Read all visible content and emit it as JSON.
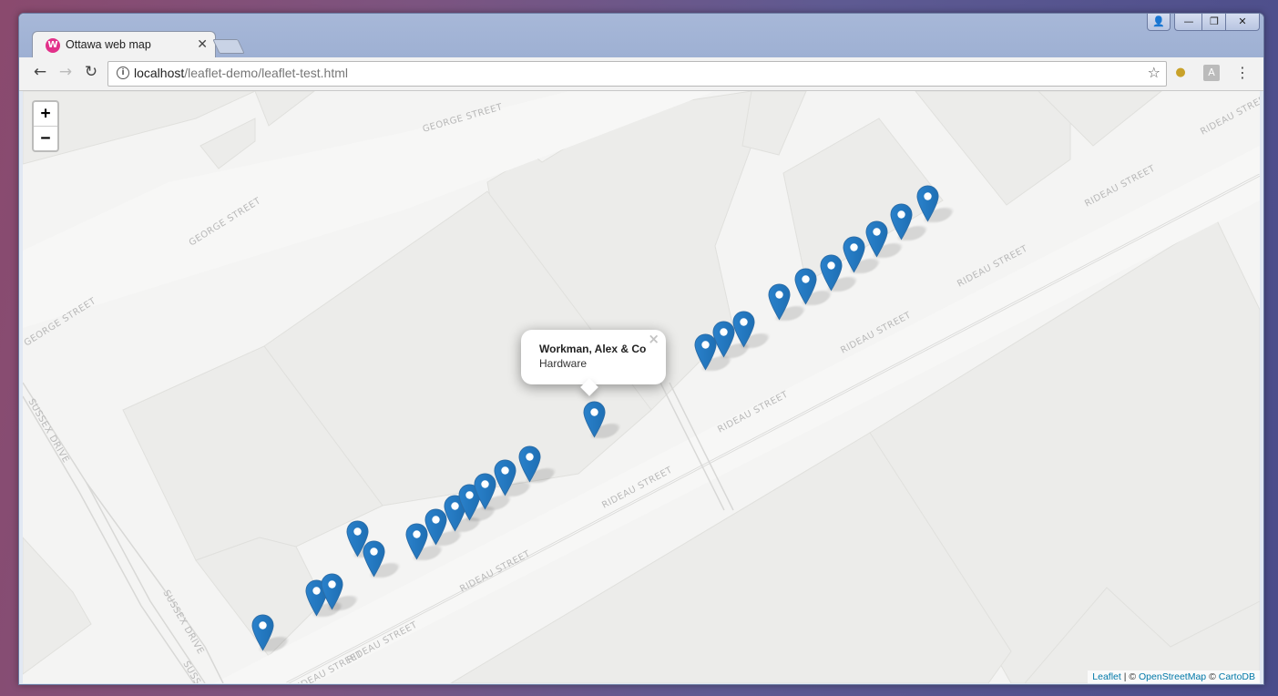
{
  "browser": {
    "tab_title": "Ottawa web map",
    "tab_close": "✕",
    "favicon_letter": "W",
    "url_host": "localhost",
    "url_path": "/leaflet-demo/leaflet-test.html",
    "window_user": "👤",
    "window_min": "—",
    "window_max": "❐",
    "window_close": "✕"
  },
  "nav": {
    "back": "←",
    "forward": "→",
    "reload": "↻",
    "star": "☆",
    "menu": "⋮",
    "info": "i"
  },
  "map": {
    "zoom_in": "+",
    "zoom_out": "−",
    "street_labels": {
      "george": "GEORGE STREET",
      "rideau": "RIDEAU STREET",
      "sussex": "SUSSEX DRIVE"
    },
    "popup": {
      "title": "Workman, Alex & Co",
      "subtitle": "Hardware",
      "close": "×"
    },
    "marker_color": "#2a81cb",
    "attribution": {
      "leaflet": "Leaflet",
      "sep1": " | © ",
      "osm": "OpenStreetMap",
      "sep2": " © ",
      "carto": "CartoDB"
    }
  }
}
